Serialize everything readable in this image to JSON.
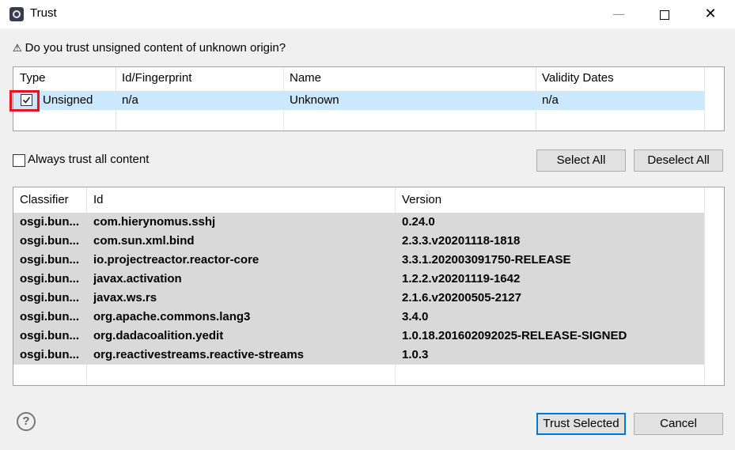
{
  "window": {
    "title": "Trust",
    "controls": {
      "minimize": "—",
      "close": "✕"
    }
  },
  "prompt": {
    "icon": "⚠",
    "text": "Do you trust unsigned content of unknown origin?"
  },
  "signers_table": {
    "columns": [
      "Type",
      "Id/Fingerprint",
      "Name",
      "Validity Dates"
    ],
    "rows": [
      {
        "checked": true,
        "type": "Unsigned",
        "id": "n/a",
        "name": "Unknown",
        "validity": "n/a"
      }
    ]
  },
  "always_trust": {
    "label": "Always trust all content",
    "checked": false
  },
  "buttons": {
    "select_all": "Select All",
    "deselect_all": "Deselect All",
    "trust_selected": "Trust Selected",
    "cancel": "Cancel"
  },
  "artifacts_table": {
    "columns": [
      "Classifier",
      "Id",
      "Version"
    ],
    "rows": [
      [
        "osgi.bun...",
        "com.hierynomus.sshj",
        "0.24.0"
      ],
      [
        "osgi.bun...",
        "com.sun.xml.bind",
        "2.3.3.v20201118-1818"
      ],
      [
        "osgi.bun...",
        "io.projectreactor.reactor-core",
        "3.3.1.202003091750-RELEASE"
      ],
      [
        "osgi.bun...",
        "javax.activation",
        "1.2.2.v20201119-1642"
      ],
      [
        "osgi.bun...",
        "javax.ws.rs",
        "2.1.6.v20200505-2127"
      ],
      [
        "osgi.bun...",
        "org.apache.commons.lang3",
        "3.4.0"
      ],
      [
        "osgi.bun...",
        "org.dadacoalition.yedit",
        "1.0.18.201602092025-RELEASE-SIGNED"
      ],
      [
        "osgi.bun...",
        "org.reactivestreams.reactive-streams",
        "1.0.3"
      ]
    ]
  },
  "help": {
    "icon": "help-icon",
    "glyph": "?"
  }
}
